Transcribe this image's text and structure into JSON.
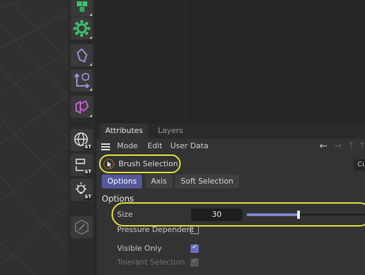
{
  "attributes": {
    "tabs": [
      {
        "label": "Attributes",
        "active": true
      },
      {
        "label": "Layers",
        "active": false
      }
    ],
    "menu": [
      "Mode",
      "Edit",
      "User Data"
    ],
    "object_name": "Brush Selection",
    "cut_button": "Cu",
    "subtabs": [
      {
        "label": "Options",
        "active": true
      },
      {
        "label": "Axis",
        "active": false
      },
      {
        "label": "Soft Selection",
        "active": false
      }
    ],
    "section_title": "Options",
    "fields": {
      "size_label": "Size",
      "size_value": "30",
      "size_slider_fraction": 0.44,
      "pressure_label": "Pressure Dependent",
      "pressure_checked": false,
      "visible_only_label": "Visible Only",
      "visible_only_checked": true,
      "tolerant_label": "Tolerant Selection",
      "tolerant_checked": true,
      "tolerant_enabled": false
    }
  },
  "palette": {
    "tools": [
      {
        "name": "cube-group-icon",
        "color": "#3ec46d"
      },
      {
        "name": "gear-points-icon",
        "color": "#3ec46d"
      },
      {
        "name": "polygon-pen-icon",
        "color": "#a58fd8"
      },
      {
        "name": "coordinate-axis-icon",
        "color": "#a58fd8"
      },
      {
        "name": "bend-deformer-icon",
        "color": "#c065c8"
      },
      {
        "name": "globe-st-icon",
        "color": "#e0e0e0"
      },
      {
        "name": "transform-st-icon",
        "color": "#e0e0e0"
      },
      {
        "name": "light-st-icon",
        "color": "#e0e0e0"
      },
      {
        "name": "edit-disabled-icon",
        "color": "#777777"
      }
    ]
  },
  "colors": {
    "accent": "#55589a",
    "highlight": "#e8e23a"
  }
}
